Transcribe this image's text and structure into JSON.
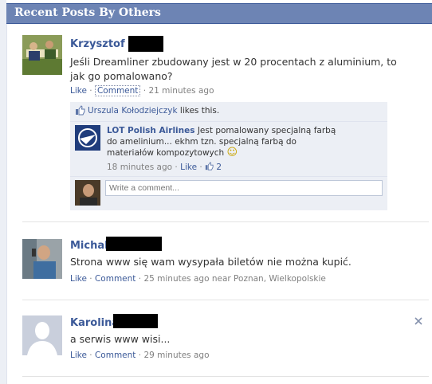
{
  "header": {
    "title": "Recent Posts By Others"
  },
  "posts": [
    {
      "author": "Krzysztof",
      "message": "Jeśli Dreamliner zbudowany jest w 20 procentach z aluminium, to jak go pomalowano?",
      "like": "Like",
      "comment": "Comment",
      "time": "21 minutes ago",
      "likes_text_name": "Urszula Kołodziejczyk",
      "likes_text_rest": " likes this.",
      "reply": {
        "author": "LOT Polish Airlines",
        "text": " Jest pomalowany specjalną farbą do amelinium... ekhm tzn. specjalną farbą do materiałów kompozytowych",
        "emoticon": "☺",
        "time": "18 minutes ago",
        "like": "Like",
        "like_count": "2"
      },
      "write_placeholder": "Write a comment..."
    },
    {
      "author": "Michal",
      "message": "Strona www się wam wysypała biletów nie można kupić.",
      "like": "Like",
      "comment": "Comment",
      "time": "25 minutes ago near Poznan, Wielkopolskie"
    },
    {
      "author": "Karolina",
      "message": "a serwis www wisi...",
      "like": "Like",
      "comment": "Comment",
      "time": "29 minutes ago"
    }
  ],
  "icons": {
    "close": "close-icon",
    "thumb": "thumbs-up-icon"
  },
  "colors": {
    "brand": "#3b5998",
    "header": "#6d84b4",
    "ufi_bg": "#eceff5"
  }
}
